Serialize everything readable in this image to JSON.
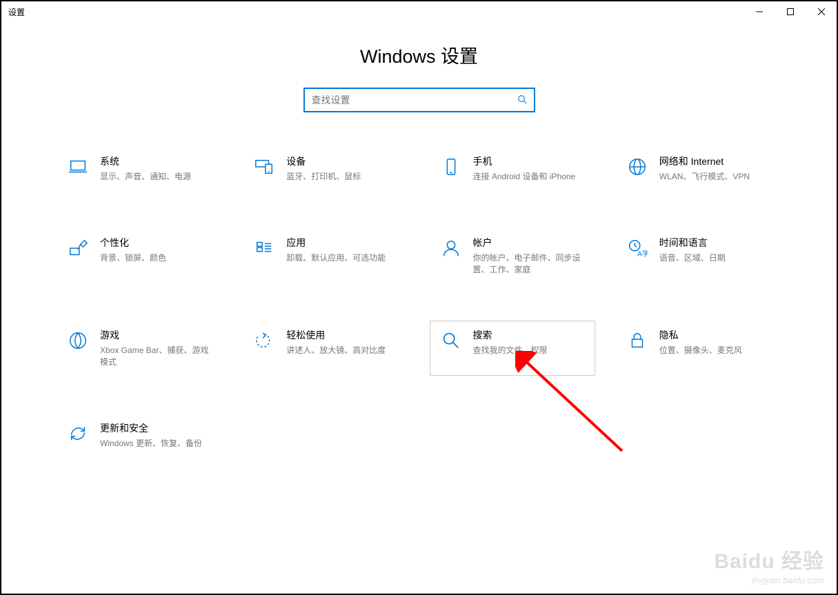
{
  "window": {
    "title": "设置"
  },
  "heading": "Windows 设置",
  "search": {
    "placeholder": "查找设置"
  },
  "tiles": {
    "system": {
      "title": "系统",
      "desc": "显示、声音、通知、电源"
    },
    "devices": {
      "title": "设备",
      "desc": "蓝牙、打印机、鼠标"
    },
    "phone": {
      "title": "手机",
      "desc": "连接 Android 设备和 iPhone"
    },
    "network": {
      "title": "网络和 Internet",
      "desc": "WLAN、飞行模式、VPN"
    },
    "personal": {
      "title": "个性化",
      "desc": "背景、锁屏、颜色"
    },
    "apps": {
      "title": "应用",
      "desc": "卸载、默认应用、可选功能"
    },
    "accounts": {
      "title": "帐户",
      "desc": "你的帐户、电子邮件、同步设置、工作、家庭"
    },
    "time": {
      "title": "时间和语言",
      "desc": "语音、区域、日期"
    },
    "gaming": {
      "title": "游戏",
      "desc": "Xbox Game Bar、捕获、游戏模式"
    },
    "ease": {
      "title": "轻松使用",
      "desc": "讲述人、放大镜、高对比度"
    },
    "searchTile": {
      "title": "搜索",
      "desc": "查找我的文件、权限"
    },
    "privacy": {
      "title": "隐私",
      "desc": "位置、摄像头、麦克风"
    },
    "update": {
      "title": "更新和安全",
      "desc": "Windows 更新、恢复、备份"
    }
  },
  "watermark": {
    "brand": "Baidu 经验",
    "url": "jingyan.baidu.com"
  }
}
